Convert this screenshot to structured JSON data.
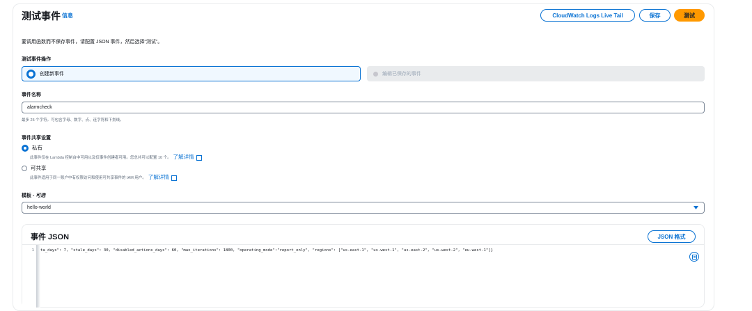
{
  "header": {
    "title": "测试事件",
    "info_link": "信息",
    "buttons": {
      "live_tail": "CloudWatch Logs Live Tail",
      "save": "保存",
      "test": "测试"
    }
  },
  "description": "要调用函数而不保存事件，请配置 JSON 事件，然后选择“测试”。",
  "event_action": {
    "label": "测试事件操作",
    "options": [
      "创建新事件",
      "编辑已保存的事件"
    ],
    "selected": "创建新事件"
  },
  "event_name": {
    "label": "事件名称",
    "value": "alarmcheck",
    "hint": "最多 25 个字符。可包含字母、数字、点、连字符和下划线。"
  },
  "sharing": {
    "label": "事件共享设置",
    "private": {
      "label": "私有",
      "desc": "此事件仅在 Lambda 控制台中可用以及仅事件创建者可用。您总共可以配置 10 个。",
      "link": "了解详情"
    },
    "shareable": {
      "label": "可共享",
      "desc": "此事件适用于同一账户中有权限访问和使用可共享事件的 IAM 用户。",
      "link": "了解详情"
    },
    "selected": "私有"
  },
  "template": {
    "label": "模板 - ",
    "optional": "可选",
    "value": "hello-world"
  },
  "event_json": {
    "title": "事件 JSON",
    "format_button": "JSON 格式",
    "line_number": "1",
    "line_text": "ta_days\": 7, \"stale_days\": 30, \"disabled_actions_days\": 60, \"max_iterations\": 1800, \"operating_mode\":\"report_only\", \"regions\": [\"us-east-1\", \"us-west-1\", \"us-east-2\", \"us-west-2\", \"eu-west-1\"]}"
  },
  "colors": {
    "accent": "#0972d3",
    "primary_button": "#ff9900",
    "disabled_tile": "#e9ebed"
  }
}
